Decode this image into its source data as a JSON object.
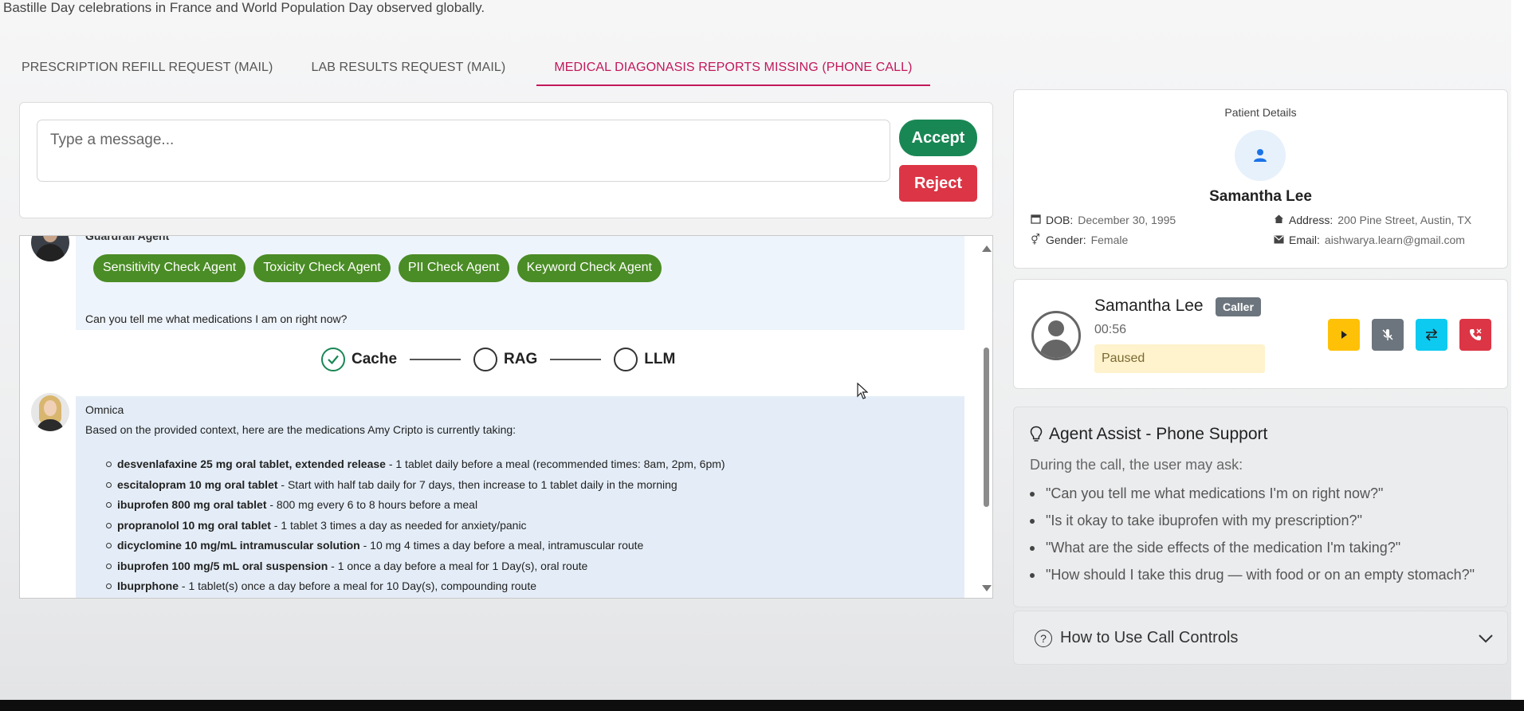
{
  "ticker": "Bastille Day celebrations in France and World Population Day observed globally.",
  "tabs": [
    {
      "label": "PRESCRIPTION REFILL REQUEST (MAIL)"
    },
    {
      "label": "LAB RESULTS REQUEST (MAIL)"
    },
    {
      "label": "MEDICAL DIAGONASIS REPORTS MISSING (PHONE CALL)"
    }
  ],
  "composer": {
    "placeholder": "Type a message...",
    "accept_label": "Accept",
    "reject_label": "Reject"
  },
  "chat": {
    "guardrail_agent_name": "Guardrail Agent",
    "agents": [
      "Sensitivity Check Agent",
      "Toxicity Check Agent",
      "PII Check Agent",
      "Keyword Check Agent"
    ],
    "user_question": "Can you tell me what medications I am on right now?",
    "pipeline": [
      "Cache",
      "RAG",
      "LLM"
    ],
    "pipeline_done": "Cache",
    "bot_name": "Omnica",
    "bot_intro": "Based on the provided context, here are the medications Amy Cripto is currently taking:",
    "medications": [
      {
        "name": "desvenlafaxine 25 mg oral tablet, extended release",
        "detail": " - 1 tablet daily before a meal (recommended times: 8am, 2pm, 6pm)"
      },
      {
        "name": "escitalopram 10 mg oral tablet",
        "detail": " - Start with half tab daily for 7 days, then increase to 1 tablet daily in the morning"
      },
      {
        "name": "ibuprofen 800 mg oral tablet",
        "detail": " - 800 mg every 6 to 8 hours before a meal"
      },
      {
        "name": "propranolol 10 mg oral tablet",
        "detail": " - 1 tablet 3 times a day as needed for anxiety/panic"
      },
      {
        "name": "dicyclomine 10 mg/mL intramuscular solution",
        "detail": " - 10 mg 4 times a day before a meal, intramuscular route"
      },
      {
        "name": "ibuprofen 100 mg/5 mL oral suspension",
        "detail": " - 1 once a day before a meal for 1 Day(s), oral route"
      },
      {
        "name": "Ibuprphone",
        "detail": " - 1 tablet(s) once a day before a meal for 10 Day(s), compounding route"
      }
    ]
  },
  "patient": {
    "section_title": "Patient Details",
    "name": "Samantha Lee",
    "dob_label": "DOB:",
    "dob": "December 30, 1995",
    "gender_label": "Gender:",
    "gender": "Female",
    "address_label": "Address:",
    "address": "200 Pine Street, Austin, TX",
    "email_label": "Email:",
    "email": "aishwarya.learn@gmail.com"
  },
  "call": {
    "caller_name": "Samantha Lee",
    "badge": "Caller",
    "duration": "00:56",
    "status": "Paused"
  },
  "assist": {
    "title": "Agent Assist - Phone Support",
    "subtitle": "During the call, the user may ask:",
    "questions": [
      "\"Can you tell me what medications I'm on right now?\"",
      "\"Is it okay to take ibuprofen with my prescription?\"",
      "\"What are the side effects of the medication I'm taking?\"",
      "\"How should I take this drug — with food or on an empty stomach?\""
    ]
  },
  "howto": {
    "title": "How to Use Call Controls"
  },
  "colors": {
    "active_tab": "#c2185b",
    "accept": "#198754",
    "reject": "#dc3545",
    "agent_chip": "#4a8c25",
    "play": "#ffc107",
    "mute": "#6c757d",
    "transfer": "#0dcaf0",
    "hangup": "#dc3545",
    "status_bg": "#fff3cd"
  }
}
